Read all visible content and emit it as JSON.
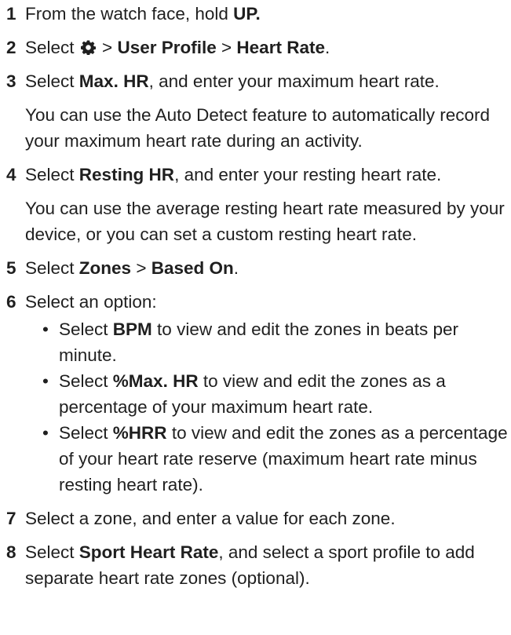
{
  "steps": [
    {
      "num": "1",
      "text": [
        "From the watch face, hold ",
        {
          "b": "UP."
        }
      ]
    },
    {
      "num": "2",
      "text": [
        "Select ",
        {
          "icon": "gear-icon"
        },
        " > ",
        {
          "b": "User Profile"
        },
        " > ",
        {
          "b": "Heart Rate"
        },
        "."
      ]
    },
    {
      "num": "3",
      "text": [
        "Select ",
        {
          "b": "Max. HR"
        },
        ", and enter your maximum heart rate."
      ],
      "note": "You can use the Auto Detect feature to automatically record your maximum heart rate during an activity."
    },
    {
      "num": "4",
      "text": [
        "Select ",
        {
          "b": "Resting HR"
        },
        ", and enter your resting heart rate."
      ],
      "note": "You can use the average resting heart rate measured by your device, or you can set a custom resting heart rate."
    },
    {
      "num": "5",
      "text": [
        "Select ",
        {
          "b": "Zones"
        },
        " > ",
        {
          "b": "Based On"
        },
        "."
      ]
    },
    {
      "num": "6",
      "text": [
        "Select an option:"
      ],
      "options": [
        [
          "Select ",
          {
            "b": "BPM"
          },
          " to view and edit the zones in beats per minute."
        ],
        [
          "Select ",
          {
            "b": "%Max. HR"
          },
          " to view and edit the zones as a percentage of your maximum heart rate."
        ],
        [
          "Select ",
          {
            "b": "%HRR"
          },
          " to view and edit the zones as a percentage of your heart rate reserve (maximum heart rate minus resting heart rate)."
        ]
      ]
    },
    {
      "num": "7",
      "text": [
        "Select a zone, and enter a value for each zone."
      ]
    },
    {
      "num": "8",
      "text": [
        "Select ",
        {
          "b": "Sport Heart Rate"
        },
        ", and select a sport profile to add separate heart rate zones (optional)."
      ]
    }
  ],
  "bullet_char": "•",
  "colors": {
    "text": "#1f1f1f"
  }
}
